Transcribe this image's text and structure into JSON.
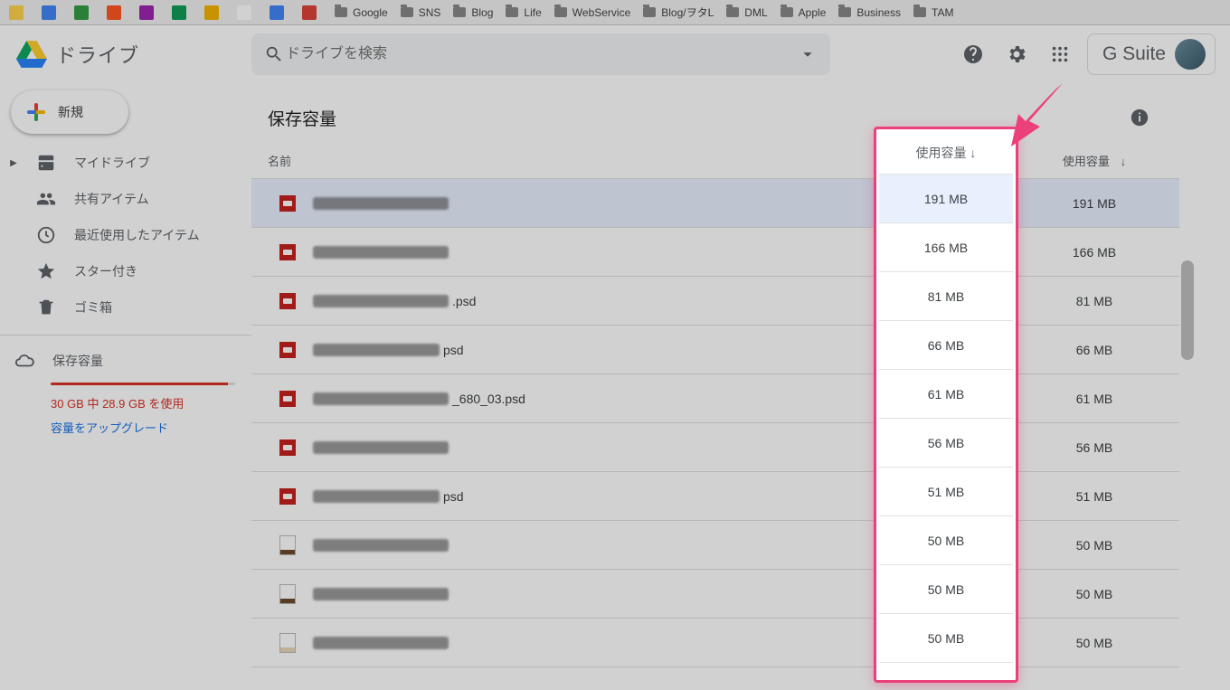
{
  "bookmarks": [
    {
      "label": "",
      "color": "#ffd24d"
    },
    {
      "label": "",
      "color": "#4285f4"
    },
    {
      "label": "",
      "color": "#359c42"
    },
    {
      "label": "",
      "color": "#ff5722"
    },
    {
      "label": "",
      "color": "#9c27b0"
    },
    {
      "label": "",
      "color": "#0f9d58"
    },
    {
      "label": "",
      "color": "#f4b400"
    },
    {
      "label": "",
      "color": "#ffffff"
    },
    {
      "label": "",
      "color": "#4285f4"
    },
    {
      "label": "",
      "color": "#db4437"
    },
    {
      "label": "Google",
      "folder": true
    },
    {
      "label": "SNS",
      "folder": true
    },
    {
      "label": "Blog",
      "folder": true
    },
    {
      "label": "Life",
      "folder": true
    },
    {
      "label": "WebService",
      "folder": true
    },
    {
      "label": "Blog/ヲタL",
      "folder": true
    },
    {
      "label": "DML",
      "folder": true
    },
    {
      "label": "Apple",
      "folder": true
    },
    {
      "label": "Business",
      "folder": true
    },
    {
      "label": "TAM",
      "folder": true
    }
  ],
  "brand": "ドライブ",
  "search": {
    "placeholder": "ドライブを検索"
  },
  "gsuite_label": "G Suite",
  "new_button": "新規",
  "sidebar": {
    "items": [
      {
        "label": "マイドライブ"
      },
      {
        "label": "共有アイテム"
      },
      {
        "label": "最近使用したアイテム"
      },
      {
        "label": "スター付き"
      },
      {
        "label": "ゴミ箱"
      }
    ],
    "storage_label": "保存容量",
    "quota_text": "30 GB 中 28.9 GB を使用",
    "upgrade_text": "容量をアップグレード"
  },
  "main": {
    "title": "保存容量",
    "col_name": "名前",
    "col_size": "使用容量",
    "sort_arrow": "↓",
    "files": [
      {
        "type": "psd",
        "suffix": "",
        "size": "191 MB",
        "blur_w": 150,
        "selected": true
      },
      {
        "type": "psd",
        "suffix": "",
        "size": "166 MB",
        "blur_w": 150
      },
      {
        "type": "psd",
        "suffix": ".psd",
        "size": "81 MB",
        "blur_w": 150
      },
      {
        "type": "psd",
        "suffix": "psd",
        "size": "66 MB",
        "blur_w": 140
      },
      {
        "type": "psd",
        "suffix": "_680_03.psd",
        "size": "61 MB",
        "blur_w": 150
      },
      {
        "type": "psd",
        "suffix": "",
        "size": "56 MB",
        "blur_w": 150
      },
      {
        "type": "psd",
        "suffix": "psd",
        "size": "51 MB",
        "blur_w": 140
      },
      {
        "type": "doc",
        "suffix": "",
        "size": "50 MB",
        "blur_w": 150
      },
      {
        "type": "doc",
        "suffix": "",
        "size": "50 MB",
        "blur_w": 150
      },
      {
        "type": "doc-alt",
        "suffix": "",
        "size": "50 MB",
        "blur_w": 150
      }
    ]
  }
}
